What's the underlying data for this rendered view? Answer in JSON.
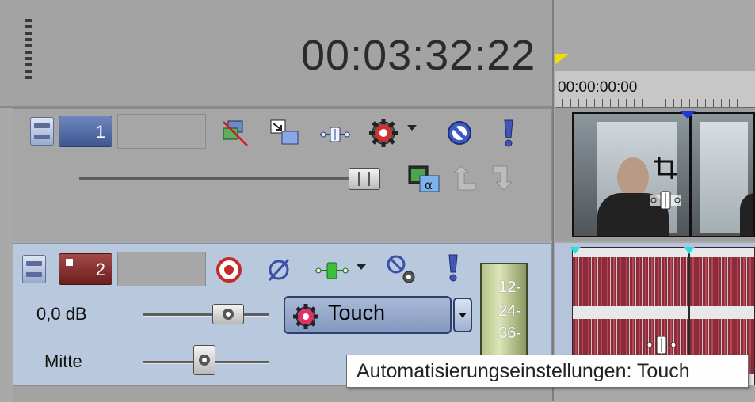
{
  "header": {
    "timecode": "00:03:32:22"
  },
  "track1": {
    "number": "1",
    "icons": [
      "compositing-mode-icon",
      "make-compositing-child-icon",
      "track-motion-icon",
      "track-fx-icon",
      "mute-icon",
      "solo-icon"
    ],
    "secondary_icons": [
      "level-slider",
      "compositing-alpha-icon",
      "parent-up-icon",
      "child-down-icon"
    ]
  },
  "track2": {
    "number": "2",
    "volume_label": "0,0 dB",
    "pan_label": "Mitte",
    "automation_mode": "Touch",
    "meter_ticks": [
      "12-",
      "24-",
      "36-"
    ]
  },
  "timeline": {
    "ruler_time": "00:00:00:00"
  },
  "tooltip": {
    "text": "Automatisierungseinstellungen: Touch"
  },
  "colors": {
    "audio_track_bg": "#b8c9de",
    "video_track_num": "#3f5791",
    "audio_track_num": "#6d1d1d",
    "wave": "#8e2b39"
  }
}
